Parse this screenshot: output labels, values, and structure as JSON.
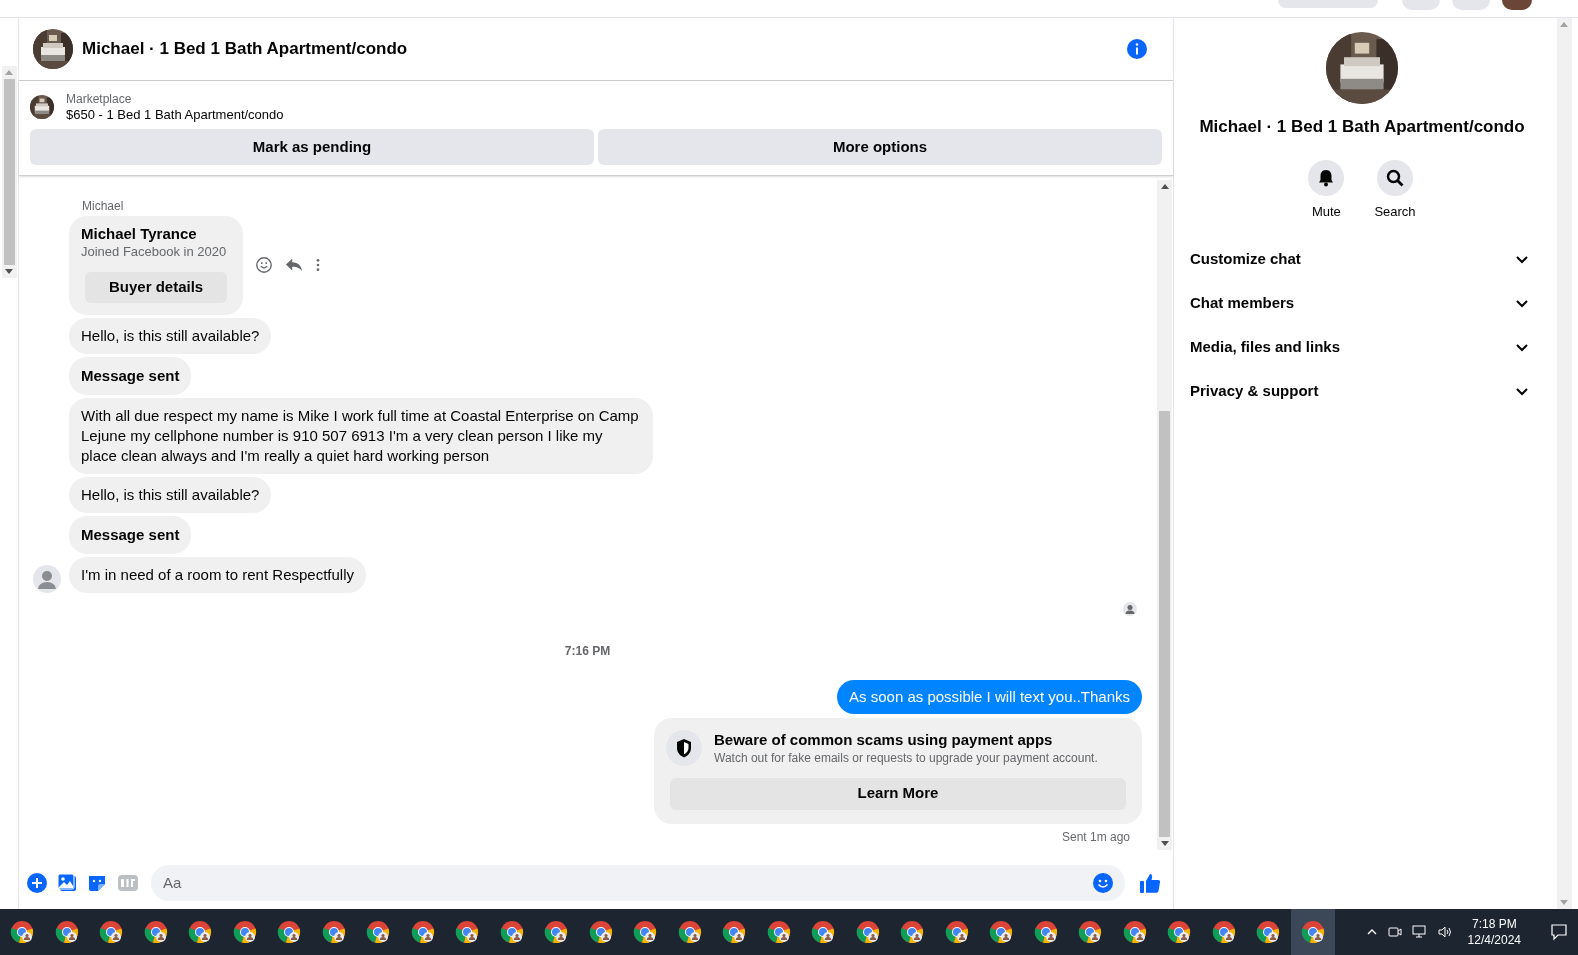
{
  "header": {
    "title": "Michael · 1 Bed 1 Bath Apartment/condo"
  },
  "listing": {
    "source": "Marketplace",
    "title": "$650 - 1 Bed 1 Bath Apartment/condo",
    "actions": [
      "Mark as pending",
      "More options"
    ]
  },
  "sender_label": "Michael",
  "messages": [
    {
      "kind": "profile",
      "name": "Michael Tyrance",
      "subtitle": "Joined Facebook in 2020",
      "button": "Buyer details",
      "avatar": false
    },
    {
      "kind": "text",
      "text": "Hello, is this still available?",
      "avatar": false
    },
    {
      "kind": "status",
      "text": "Message sent",
      "avatar": false
    },
    {
      "kind": "text",
      "text": "With all due respect my name is Mike I work full time at Coastal Enterprise on Camp Lejune my cellphone number is 910 507 6913 I'm a very clean person I like my place clean always and I'm really a quiet hard working person",
      "avatar": false
    },
    {
      "kind": "text",
      "text": "Hello, is this still available?",
      "avatar": false
    },
    {
      "kind": "status",
      "text": "Message sent",
      "avatar": false
    },
    {
      "kind": "text",
      "text": "I'm in need of a room to rent Respectfully",
      "avatar": true
    }
  ],
  "timestamp": "7:16 PM",
  "outgoing": {
    "text": "As soon as possible I will text you..Thanks"
  },
  "notice": {
    "title": "Beware of common scams using payment apps",
    "body": "Watch out for fake emails or requests to upgrade your payment account.",
    "button": "Learn More"
  },
  "delivery_status": "Sent 1m ago",
  "composer": {
    "placeholder": "Aa"
  },
  "panel": {
    "title": "Michael · 1 Bed 1 Bath Apartment/condo",
    "actions": [
      {
        "kind": "mute",
        "label": "Mute"
      },
      {
        "kind": "search",
        "label": "Search"
      }
    ],
    "sections": [
      {
        "label": "Customize chat",
        "expanded": false
      },
      {
        "label": "Chat members",
        "expanded": false
      },
      {
        "label": "Media, files and links",
        "expanded": false
      },
      {
        "label": "Privacy & support",
        "expanded": false
      }
    ]
  },
  "taskbar": {
    "apps": [
      {
        "selected": false
      },
      {
        "selected": false
      },
      {
        "selected": false
      },
      {
        "selected": false
      },
      {
        "selected": false
      },
      {
        "selected": false
      },
      {
        "selected": false
      },
      {
        "selected": false
      },
      {
        "selected": false
      },
      {
        "selected": false
      },
      {
        "selected": false
      },
      {
        "selected": false
      },
      {
        "selected": false
      },
      {
        "selected": false
      },
      {
        "selected": false
      },
      {
        "selected": false
      },
      {
        "selected": false
      },
      {
        "selected": false
      },
      {
        "selected": false
      },
      {
        "selected": false
      },
      {
        "selected": false
      },
      {
        "selected": false
      },
      {
        "selected": false
      },
      {
        "selected": false
      },
      {
        "selected": false
      },
      {
        "selected": false
      },
      {
        "selected": false
      },
      {
        "selected": false
      },
      {
        "selected": false
      },
      {
        "selected": true
      }
    ],
    "time": "7:18 PM",
    "date": "12/4/2024"
  }
}
